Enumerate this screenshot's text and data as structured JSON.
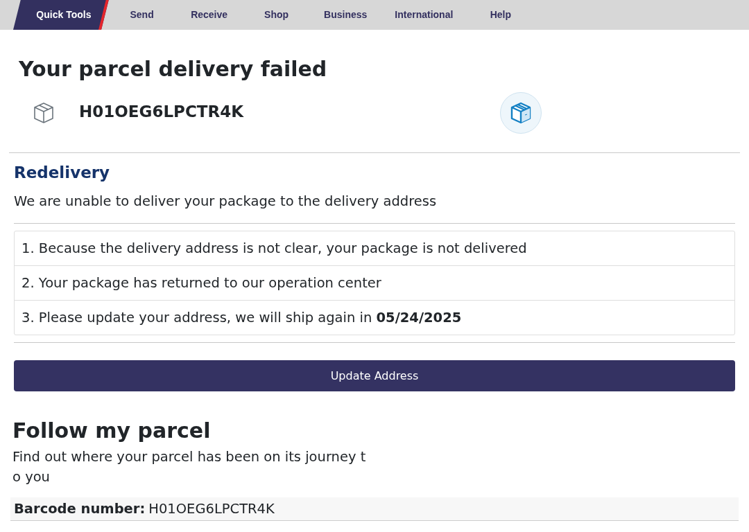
{
  "nav": {
    "tabs": [
      {
        "label": "Quick Tools",
        "selected": true
      },
      {
        "label": "Send",
        "selected": false
      },
      {
        "label": "Receive",
        "selected": false
      },
      {
        "label": "Shop",
        "selected": false
      },
      {
        "label": "Business",
        "selected": false
      },
      {
        "label": "International",
        "selected": false
      },
      {
        "label": "Help",
        "selected": false
      }
    ]
  },
  "status": {
    "title": "Your parcel delivery failed",
    "tracking_number": "H01OEG6LPCTR4K"
  },
  "redelivery": {
    "title": "Redelivery",
    "message": "We are unable to deliver your package to the delivery address",
    "reasons": [
      "1. Because the delivery address is not clear, your package is not delivered",
      "2. Your package has returned to our operation center",
      "3. Please update your address, we will ship again in **05/24/2025**"
    ],
    "button": "Update Address"
  },
  "follow": {
    "title": "Follow my parcel",
    "description": "Find out where your parcel has been on its journey to you",
    "barcode_label": "Barcode number:",
    "barcode": "H01OEG6LPCTR4K"
  }
}
